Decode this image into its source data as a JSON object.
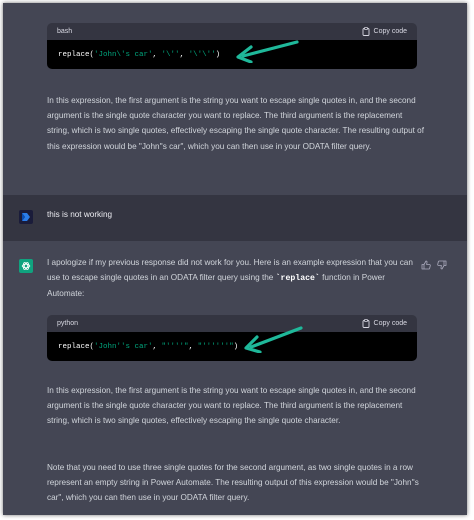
{
  "code1": {
    "lang": "bash",
    "copy_label": "Copy code",
    "tokens": [
      "replace(",
      "'John\\'s car'",
      ", ",
      "'\\''",
      ", ",
      "'\\'\\''",
      ")"
    ]
  },
  "para1": "In this expression, the first argument is the string you want to escape single quotes in, and the second argument is the single quote character you want to replace. The third argument is the replacement string, which is two single quotes, effectively escaping the single quote character. The resulting output of this expression would be \"John''s car\", which you can then use in your ODATA filter query.",
  "user_message": "this is not working",
  "reply_intro": {
    "before": "I apologize if my previous response did not work for you. Here is an example expression that you can use to escape single quotes in an ODATA filter query using the ",
    "code": "`replace`",
    "after": " function in Power Automate:"
  },
  "code2": {
    "lang": "python",
    "copy_label": "Copy code",
    "tokens": [
      "replace(",
      "'John''s car'",
      ", ",
      "\"''''\"",
      ", ",
      "\"''''''\"",
      ")"
    ]
  },
  "para2": "In this expression, the first argument is the string you want to escape single quotes in, and the second argument is the single quote character you want to replace. The third argument is the replacement string, which is two single quotes, effectively escaping the single quote character.",
  "para3": "Note that you need to use three single quotes for the second argument, as two single quotes in a row represent an empty string in Power Automate. The resulting output of this expression would be \"John''s car\", which you can then use in your ODATA filter query.",
  "colors": {
    "assistant_bg": "#444654",
    "user_bg": "#343541",
    "accent_green": "#10a37f",
    "arrow_teal": "#1fb89a",
    "code_string": "#00a67d"
  },
  "icons": {
    "copy": "clipboard-icon",
    "user_avatar": "power-automate-icon",
    "assistant_avatar": "openai-logo-icon",
    "thumbs_up": "thumbs-up-icon",
    "thumbs_down": "thumbs-down-icon"
  }
}
